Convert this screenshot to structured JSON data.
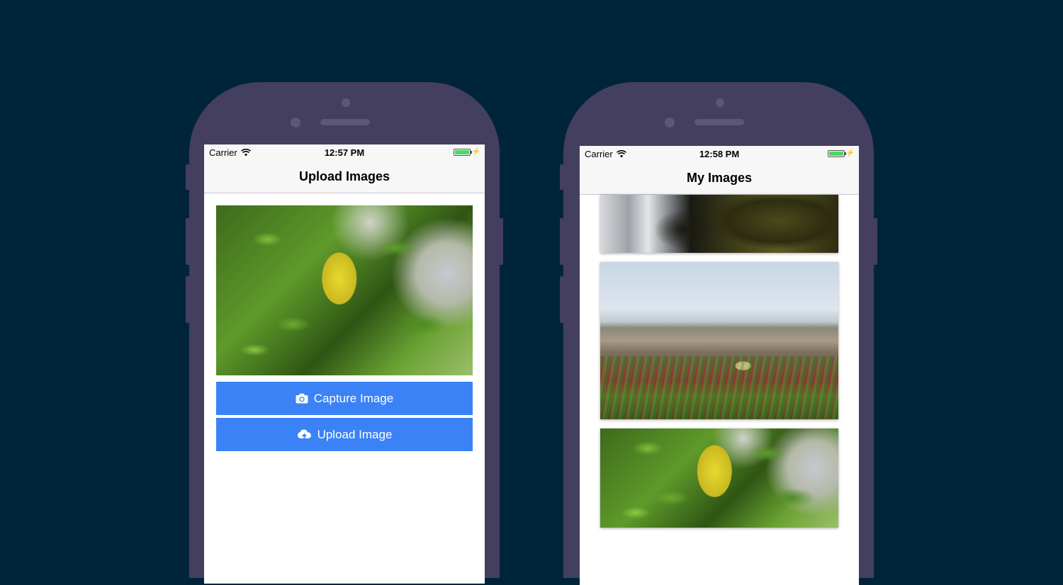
{
  "left_phone": {
    "status": {
      "carrier": "Carrier",
      "time": "12:57 PM"
    },
    "nav_title": "Upload Images",
    "buttons": {
      "capture_label": "Capture Image",
      "upload_label": "Upload Image"
    }
  },
  "right_phone": {
    "status": {
      "carrier": "Carrier",
      "time": "12:58 PM"
    },
    "nav_title": "My Images"
  },
  "colors": {
    "background": "#00253a",
    "phone_body": "#443f5f",
    "button_blue": "#3b82f6",
    "battery_green": "#4cd964"
  }
}
